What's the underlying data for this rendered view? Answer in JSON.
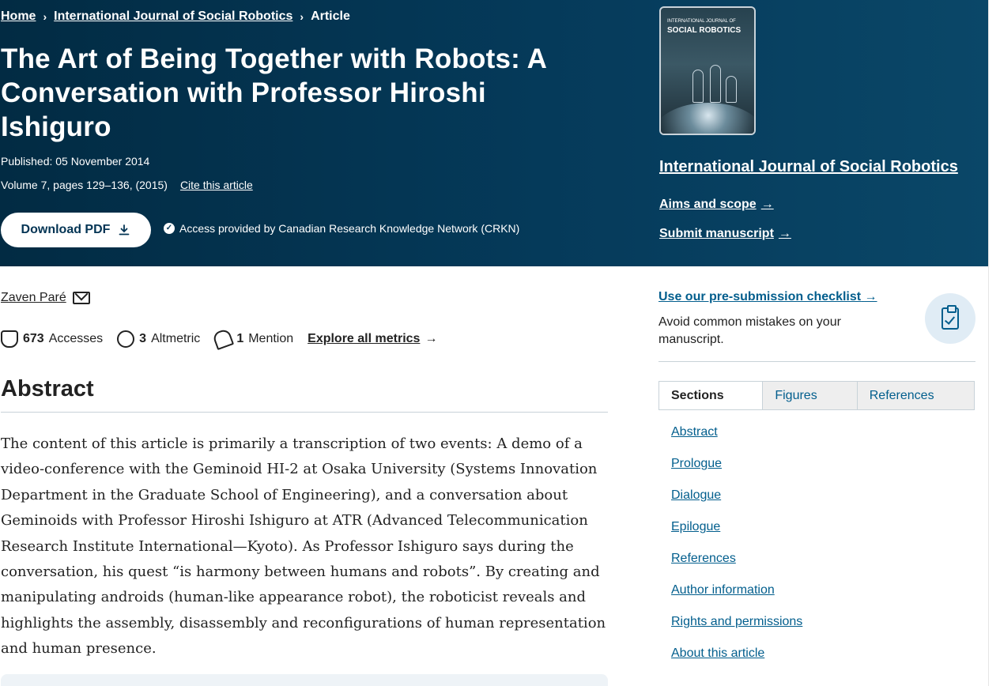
{
  "breadcrumb": {
    "home": "Home",
    "separator": "›",
    "journal": "International Journal of Social Robotics",
    "current": "Article"
  },
  "article": {
    "title": "The Art of Being Together with Robots: A Conversation with Professor Hiroshi Ishiguro",
    "published": "Published: 05 November 2014",
    "volume": "Volume 7, pages 129–136, (2015)",
    "cite_label": "Cite this article",
    "download_label": "Download PDF",
    "access_text": "Access provided by Canadian Research Knowledge Network (CRKN)"
  },
  "journal_panel": {
    "cover_title_top": "INTERNATIONAL JOURNAL OF",
    "cover_title_main": "SOCIAL ROBOTICS",
    "name": "International Journal of Social Robotics",
    "aims_label": "Aims and scope",
    "submit_label": "Submit manuscript",
    "arrow": "→"
  },
  "author": {
    "name": "Zaven Paré"
  },
  "metrics": {
    "accesses_count": "673",
    "accesses_label": "Accesses",
    "altmetric_count": "3",
    "altmetric_label": "Altmetric",
    "mention_count": "1",
    "mention_label": "Mention",
    "explore_label": "Explore all metrics",
    "arrow": "→"
  },
  "abstract": {
    "heading": "Abstract",
    "text": "The content of this article is primarily a transcription of two events: A demo of a video-conference with the Geminoid HI-2 at Osaka University (Systems Innovation Department in the Graduate School of Engineering), and a conversation about Geminoids with Professor Hiroshi Ishiguro at ATR (Advanced Telecommunication Research Institute International—Kyoto). As Professor Ishiguro says during the conversation, his quest “is harmony between humans and robots”. By creating and manipulating androids (human-like appearance robot), the roboticist reveals and highlights the assembly, disassembly and reconfigurations of human representation and human presence."
  },
  "sidebar": {
    "checklist_link": "Use our pre-submission checklist",
    "arrow": "→",
    "checklist_sub": "Avoid common mistakes on your manuscript.",
    "tabs": [
      "Sections",
      "Figures",
      "References"
    ],
    "sections": [
      "Abstract",
      "Prologue",
      "Dialogue",
      "Epilogue",
      "References",
      "Author information",
      "Rights and permissions",
      "About this article"
    ]
  },
  "colors": {
    "header_bg": "#033454",
    "link_blue": "#025e8d",
    "tab_bg": "#eeeeee"
  }
}
